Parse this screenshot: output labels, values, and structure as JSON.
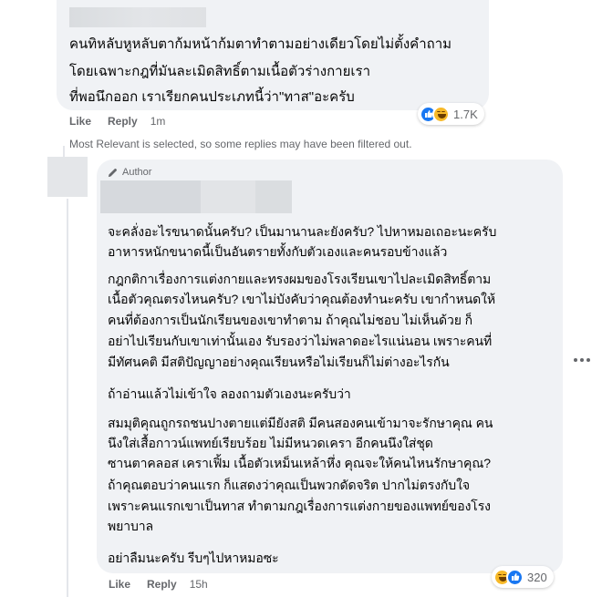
{
  "comment1": {
    "lines": [
      "คนทิหลับหูหลับตาก้มหน้าก้มตาทำตามอย่างเดียวโดยไม่ตั้งคำถาม",
      "โดยเฉพาะกฎที่มันละเมิดสิทธิ์ตามเนื้อตัวร่างกายเรา",
      "ที่พอนึกออก เราเรียกคนประเภทนี้ว่า\"ทาส\"อะครับ"
    ],
    "reactions": {
      "icons": [
        "like-icon",
        "haha-icon"
      ],
      "count": "1.7K"
    },
    "actions": {
      "like": "Like",
      "reply": "Reply",
      "time": "1m"
    }
  },
  "notice": "Most Relevant is selected, so some replies may have been filtered out.",
  "reply": {
    "author_badge": "Author",
    "paragraphs": [
      [
        "จะคลั่งอะไรขนาดนั้นครับ? เป็นมานานละยังครับ? ไปหาหมอเถอะนะครับ",
        "อาหารหนักขนาดนี้เป็นอันตรายทั้งกับตัวเองและคนรอบข้างแล้ว"
      ],
      [
        "กฎกติกาเรื่องการแต่งกายและทรงผมของโรงเรียนเขาไปละเมิดสิทธิ์ตาม",
        "เนื้อตัวคุณตรงไหนครับ? เขาไม่บังคับว่าคุณต้องทำนะครับ เขากำหนดให้",
        "คนที่ต้องการเป็นนักเรียนของเขาทำตาม ถ้าคุณไม่ชอบ ไม่เห็นด้วย ก็",
        "อย่าไปเรียนกับเขาเท่านั้นเอง รับรองว่าไม่พลาดอะไรแน่นอน เพราะคนที่",
        "มีทัศนคติ มีสติปัญญาอย่างคุณเรียนหรือไม่เรียนก็ไม่ต่างอะไรกัน"
      ],
      [
        "ถ้าอ่านแล้วไม่เข้าใจ ลองถามตัวเองนะครับว่า"
      ],
      [
        "สมมุติคุณถูกรถชนปางตายแต่มียังสติ มีคนสองคนเข้ามาจะรักษาคุณ คน",
        "นึงใส่เสื้อกาวน์แพทย์เรียบร้อย ไม่มีหนวดเครา อีกคนนึงใส่ชุด",
        "ซานตาคลอส เคราเฟิ้ม เนื้อตัวเหม็นเหล้าหึ่ง คุณจะให้คนไหนรักษาคุณ?"
      ],
      [
        "ถ้าคุณตอบว่าคนแรก ก็แสดงว่าคุณเป็นพวกดัดจริต ปากไม่ตรงกับใจ",
        "เพราะคนแรกเขาเป็นทาส ทำตามกฎเรื่องการแต่งกายของแพทย์ของโรง",
        "พยาบาล"
      ],
      [
        "อย่าลืมนะครับ รีบๆไปหาหมอซะ"
      ]
    ],
    "reactions": {
      "icons": [
        "haha-icon",
        "like-icon"
      ],
      "count": "320"
    },
    "actions": {
      "like": "Like",
      "reply": "Reply",
      "time": "15h"
    }
  },
  "colors": {
    "bubble": "#f0f2f5",
    "secondary_text": "#65676b",
    "like_blue": "#1877f2",
    "haha_yellow": "#f7b928"
  }
}
